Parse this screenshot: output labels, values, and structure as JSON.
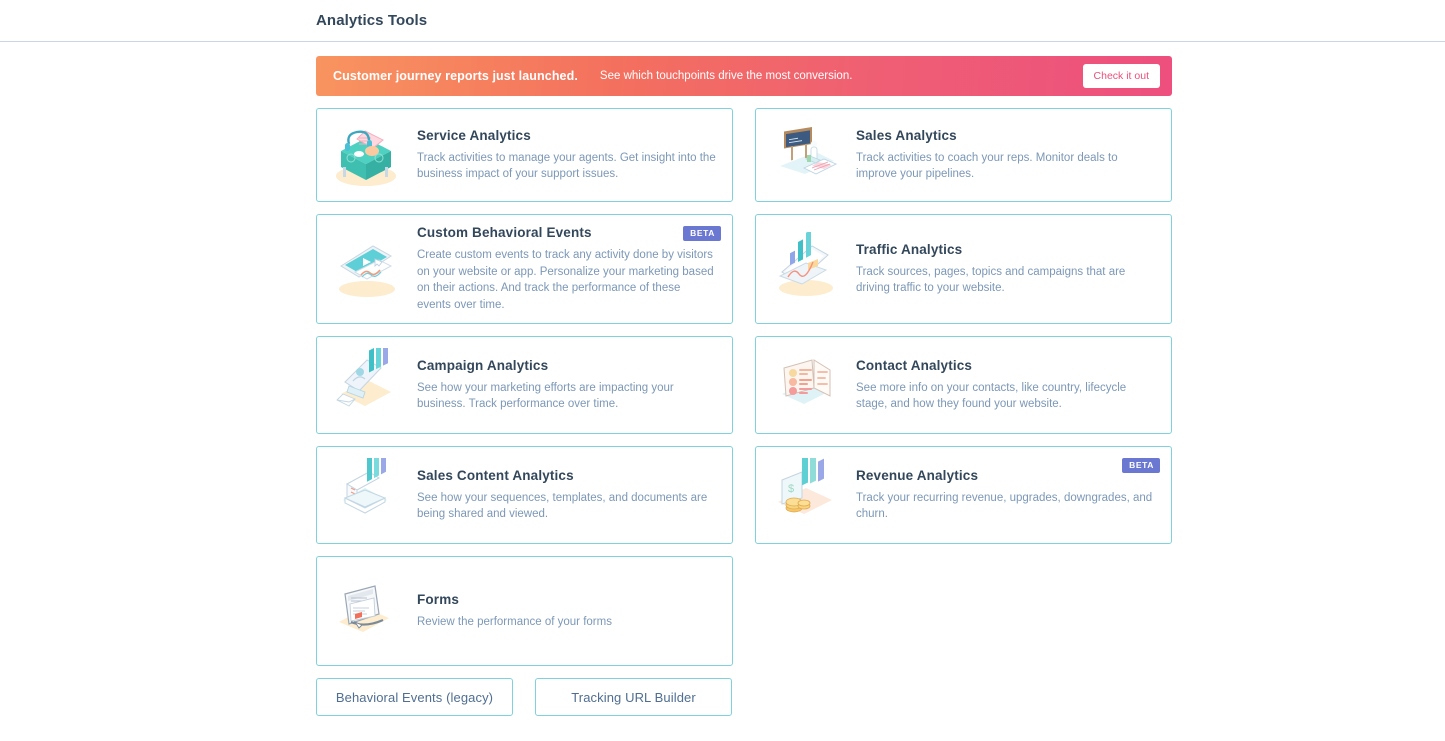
{
  "header": {
    "title": "Analytics Tools"
  },
  "banner": {
    "headline": "Customer journey reports just launched.",
    "subtext": "See which touchpoints drive the most conversion.",
    "cta_label": "Check it out",
    "gradient_start": "#f8945f",
    "gradient_end": "#ee4f7e",
    "cta_text_color": "#e8517c"
  },
  "colors": {
    "card_border": "#7fd1de",
    "title": "#33475b",
    "description": "#7c98b6",
    "beta_badge": "#6a78d1",
    "header_rule": "#cbd6e2"
  },
  "cards": [
    {
      "id": "service-analytics",
      "title": "Service Analytics",
      "description": "Track activities to manage your agents. Get insight into the business impact of your support issues.",
      "icon": "service-desk-icon",
      "beta": false
    },
    {
      "id": "sales-analytics",
      "title": "Sales Analytics",
      "description": "Track activities to coach your reps. Monitor deals to improve your pipelines.",
      "icon": "sales-coaching-icon",
      "beta": false
    },
    {
      "id": "custom-behavioral-events",
      "title": "Custom Behavioral Events",
      "description": "Create custom events to track any activity done by visitors on your website or app. Personalize your marketing based on their actions. And track the performance of these events over time.",
      "icon": "video-screen-icon",
      "beta": true,
      "beta_label": "BETA"
    },
    {
      "id": "traffic-analytics",
      "title": "Traffic Analytics",
      "description": "Track sources, pages, topics and campaigns that are driving traffic to your website.",
      "icon": "laptop-chart-icon",
      "beta": false
    },
    {
      "id": "campaign-analytics",
      "title": "Campaign Analytics",
      "description": "See how your marketing efforts are impacting your business. Track performance over time.",
      "icon": "campaign-monitor-icon",
      "beta": false
    },
    {
      "id": "contact-analytics",
      "title": "Contact Analytics",
      "description": "See more info on your contacts, like country, lifecycle stage, and how they found your website.",
      "icon": "contact-list-icon",
      "beta": false
    },
    {
      "id": "sales-content-analytics",
      "title": "Sales Content Analytics",
      "description": "See how your sequences, templates, and documents are being shared and viewed.",
      "icon": "document-chart-icon",
      "beta": false
    },
    {
      "id": "revenue-analytics",
      "title": "Revenue Analytics",
      "description": "Track your recurring revenue, upgrades, downgrades, and churn.",
      "icon": "revenue-coins-icon",
      "beta": true,
      "beta_label": "BETA"
    },
    {
      "id": "forms",
      "title": "Forms",
      "description": "Review the performance of your forms",
      "icon": "form-screen-icon",
      "beta": false
    }
  ],
  "footer_actions": [
    {
      "id": "behavioral-events-legacy",
      "label": "Behavioral Events (legacy)"
    },
    {
      "id": "tracking-url-builder",
      "label": "Tracking URL Builder"
    }
  ]
}
